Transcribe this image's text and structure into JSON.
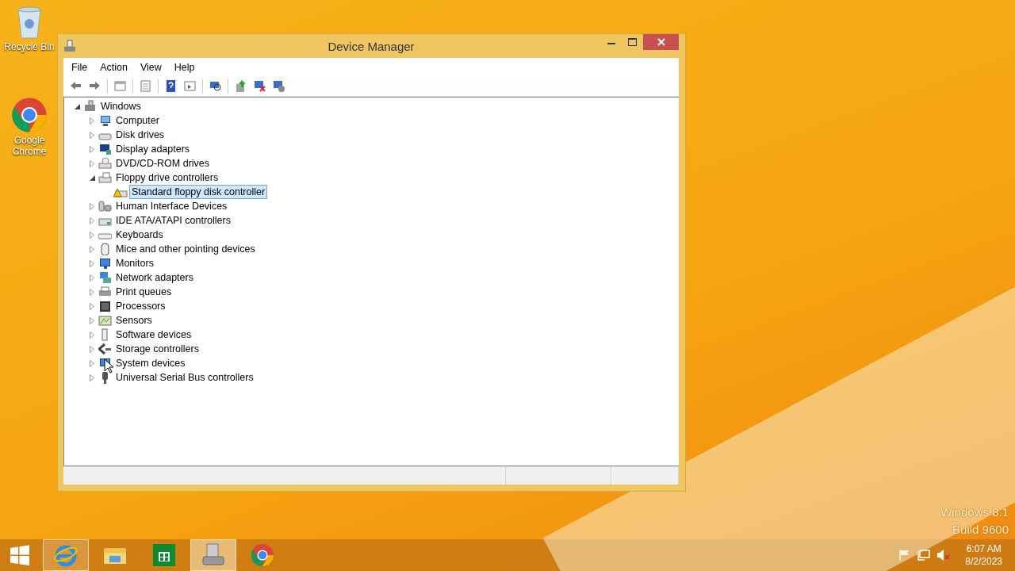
{
  "desktop_icons": [
    {
      "label": "Recycle Bin"
    },
    {
      "label": "Google Chrome"
    }
  ],
  "window": {
    "title": "Device Manager",
    "active": true
  },
  "menu": [
    "File",
    "Action",
    "View",
    "Help"
  ],
  "toolbar": [
    {
      "enabled": true
    },
    {
      "enabled": true
    },
    {
      "enabled": true
    },
    {
      "enabled": true
    },
    {
      "enabled": true
    },
    {
      "enabled": true
    },
    {
      "enabled": true
    },
    {
      "enabled": true
    },
    {
      "enabled": true
    },
    {
      "enabled": true
    }
  ],
  "tree": {
    "label": "Windows",
    "expanded": true,
    "selected": false,
    "children": [
      {
        "label": "Computer",
        "expanded": false,
        "selected": false
      },
      {
        "label": "Disk drives",
        "expanded": false,
        "selected": false
      },
      {
        "label": "Display adapters",
        "expanded": false,
        "selected": false
      },
      {
        "label": "DVD/CD-ROM drives",
        "expanded": false,
        "selected": false
      },
      {
        "label": "Floppy drive controllers",
        "expanded": true,
        "selected": false,
        "children": [
          {
            "label": "Standard floppy disk controller",
            "selected": true,
            "warning": true
          }
        ]
      },
      {
        "label": "Human Interface Devices",
        "expanded": false,
        "selected": false
      },
      {
        "label": "IDE ATA/ATAPI controllers",
        "expanded": false,
        "selected": false
      },
      {
        "label": "Keyboards",
        "expanded": false,
        "selected": false
      },
      {
        "label": "Mice and other pointing devices",
        "expanded": false,
        "selected": false
      },
      {
        "label": "Monitors",
        "expanded": false,
        "selected": false
      },
      {
        "label": "Network adapters",
        "expanded": false,
        "selected": false
      },
      {
        "label": "Print queues",
        "expanded": false,
        "selected": false
      },
      {
        "label": "Processors",
        "expanded": false,
        "selected": false
      },
      {
        "label": "Sensors",
        "expanded": false,
        "selected": false
      },
      {
        "label": "Software devices",
        "expanded": false,
        "selected": false
      },
      {
        "label": "Storage controllers",
        "expanded": false,
        "selected": false
      },
      {
        "label": "System devices",
        "expanded": false,
        "selected": false
      },
      {
        "label": "Universal Serial Bus controllers",
        "expanded": false,
        "selected": false
      }
    ]
  },
  "watermark_text": [
    "Windows 8.1",
    "Build 9600"
  ],
  "taskbar_apps": [
    {
      "active": false,
      "running": true
    },
    {
      "active": false,
      "running": false
    },
    {
      "active": false,
      "running": false
    },
    {
      "active": true,
      "running": true
    },
    {
      "active": false,
      "running": false
    }
  ],
  "clock": {
    "time": "6:07 AM",
    "date": "8/2/2023"
  }
}
